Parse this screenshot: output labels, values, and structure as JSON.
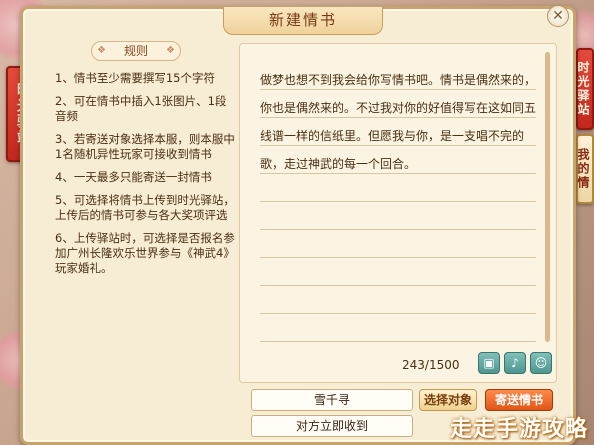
{
  "window": {
    "title": "新建情书",
    "close_icon": "close-icon"
  },
  "side_tabs": {
    "left_label": "时光驿站",
    "right_top_label": "时光驿站",
    "right_bottom_label": "我的情书"
  },
  "rules": {
    "header": "规则",
    "items": [
      "1、情书至少需要撰写15个字符",
      "2、可在情书中插入1张图片、1段音频",
      "3、若寄送对象选择本服，则本服中1名随机异性玩家可接收到情书",
      "4、一天最多只能寄送一封情书",
      "5、可选择将情书上传到时光驿站，上传后的情书可参与各大奖项评选",
      "6、上传驿站时，可选择是否报名参加广州长隆欢乐世界参与《神武4》玩家婚礼。"
    ]
  },
  "letter": {
    "content": "做梦也想不到我会给你写情书吧。情书是偶然来的，你也是偶然来的。不过我对你的好值得写在这如同五线谱一样的信纸里。但愿我与你，是一支唱不完的歌，走过神武的每一个回合。",
    "counter": "243/1500",
    "tools": [
      "image-icon",
      "microphone-icon",
      "emoji-icon"
    ]
  },
  "bottom": {
    "recipient_value": "雪千寻",
    "delivery_value": "对方立即收到",
    "select_target_label": "选择对象",
    "send_label": "寄送情书"
  },
  "watermark": "走走手游攻略"
}
